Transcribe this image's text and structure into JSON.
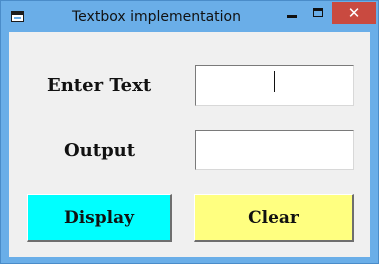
{
  "window": {
    "title": "Textbox implementation",
    "close_glyph": "✕",
    "icons": {
      "app": "app-window-icon",
      "minimize": "minimize-icon",
      "maximize": "maximize-icon",
      "close": "close-icon"
    }
  },
  "form": {
    "enter_label": "Enter Text",
    "output_label": "Output",
    "input_value": "",
    "output_value": ""
  },
  "buttons": {
    "display_label": "Display",
    "clear_label": "Clear"
  },
  "colors": {
    "titlebar": "#6aaee8",
    "close": "#c94a40",
    "display_button": "#00ffff",
    "clear_button": "#ffff80",
    "client": "#f0f0f0"
  }
}
